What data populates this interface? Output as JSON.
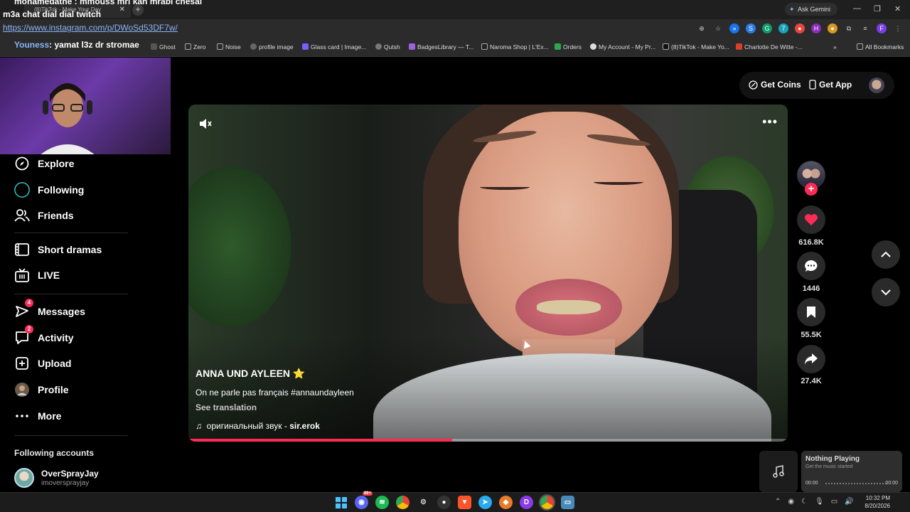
{
  "browser": {
    "tab_title": "(8)TikTok - Make Your Day",
    "url": "https://www.instagram.com/p/DWoSd53DF7w/",
    "gemini_label": "Ask Gemini",
    "bookmarks": [
      "Ghost",
      "Zero",
      "Noise",
      "profile image",
      "Glass card | Image...",
      "Qutsh",
      "BadgesLibrary — T...",
      "Naroma Shop | L'Ex...",
      "Orders",
      "My Account - My Pr...",
      "(8)TikTok - Make Yo...",
      "Charlotte De Witte -..."
    ],
    "all_bookmarks": "All Bookmarks"
  },
  "chat_overlay": {
    "line1": "mohamedathe : mmouss mri kan mrabi chesal",
    "line2": "m3a chat dial dial twitch",
    "line3_user": "Youness",
    "line3_text": ": yamat l3z dr stromae"
  },
  "sidebar": {
    "items": [
      {
        "label": "Explore",
        "icon": "compass-icon"
      },
      {
        "label": "Following",
        "icon": "following-icon"
      },
      {
        "label": "Friends",
        "icon": "friends-icon"
      },
      {
        "label": "Short dramas",
        "icon": "film-icon"
      },
      {
        "label": "LIVE",
        "icon": "live-icon"
      },
      {
        "label": "Messages",
        "icon": "messages-icon",
        "badge": "4"
      },
      {
        "label": "Activity",
        "icon": "activity-icon",
        "badge": "2"
      },
      {
        "label": "Upload",
        "icon": "upload-icon"
      },
      {
        "label": "Profile",
        "icon": "profile-icon"
      },
      {
        "label": "More",
        "icon": "more-icon"
      }
    ],
    "following_title": "Following accounts",
    "following": [
      {
        "name": "OverSprayJay",
        "handle": "imoversprayjay"
      }
    ]
  },
  "header": {
    "get_coins": "Get Coins",
    "get_app": "Get App"
  },
  "video": {
    "author": "ANNA UND AYLEEN",
    "author_emoji": "⭐",
    "description": "On ne parle pas français #annaundayleen",
    "see_translation": "See translation",
    "sound_prefix": "оригинальный звук - ",
    "sound_author": "sir.erok",
    "progress": 0.44
  },
  "actions": {
    "likes": "616.8K",
    "comments": "1446",
    "saves": "55.5K",
    "shares": "27.4K"
  },
  "colors": {
    "accent": "#fe2c55",
    "link": "#8ab4f8"
  },
  "music": {
    "title": "Nothing Playing",
    "subtitle": "Get the music started",
    "time_start": "00:00",
    "time_end": "00:00"
  },
  "taskbar": {
    "discord_badge": "99+",
    "time": "10:32 PM",
    "date": "8/20/2026"
  }
}
